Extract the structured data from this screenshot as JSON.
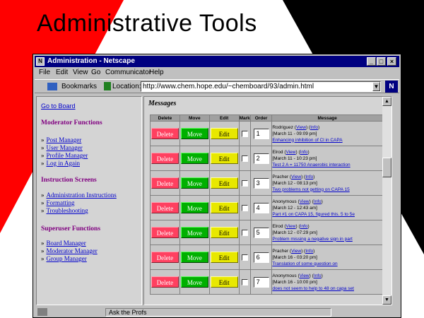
{
  "slide": {
    "title": "Administrative Tools"
  },
  "window": {
    "title": "Administration - Netscape",
    "controls": {
      "minimize": "_",
      "maximize": "□",
      "close": "×"
    }
  },
  "menubar": [
    "File",
    "Edit",
    "View",
    "Go",
    "Communicator",
    "Help"
  ],
  "toolbar": {
    "bookmarks_label": "Bookmarks",
    "location_label": "Location:",
    "url": "http://www.chem.hope.edu/~chemboard/93/admin.html",
    "logo": "N"
  },
  "sidebar": {
    "go_to_board": "Go to Board",
    "moderator_head": "Moderator Functions",
    "moderator_items": [
      "Post Manager",
      "User Manager",
      "Profile Manager",
      "Log in Again"
    ],
    "instruction_head": "Instruction Screens",
    "instruction_items": [
      "Administration Instructions",
      "Formatting",
      "Troubleshooting"
    ],
    "superuser_head": "Superuser Functions",
    "superuser_items": [
      "Board Manager",
      "Moderator Manager",
      "Group Manager"
    ],
    "bullet": "»"
  },
  "main": {
    "title": "Messages",
    "columns": [
      "Delete",
      "Move",
      "Edit",
      "Mark",
      "Order",
      "Message"
    ],
    "buttons": {
      "delete": "Delete",
      "move": "Move",
      "edit": "Edit"
    },
    "view_label": "View",
    "info_label": "Info",
    "rows": [
      {
        "order": "1",
        "author": "Rodriguez",
        "date": "[March 11 - 09:09 pm]",
        "subject": "Enhancing inhibition of Cl in CAPA"
      },
      {
        "order": "2",
        "author": "Elrod",
        "date": "[March 11 - 10:23 pm]",
        "subject": "Test 2 A = 11750 Anaerobic interaction"
      },
      {
        "order": "3",
        "author": "Pracher",
        "date": "[March 12 - 08:13 pm]",
        "subject": "Two problems not getting on CAPA 15"
      },
      {
        "order": "4",
        "author": "Anonymous",
        "date": "[March 12 - 12:43 am]",
        "subject": "Part #1 on CAPA 15, figured this. 5 to 5e"
      },
      {
        "order": "5",
        "author": "Elrod",
        "date": "[March 12 - 07:29 pm]",
        "subject": "Problem missing a negative sign in part"
      },
      {
        "order": "6",
        "author": "Pracher",
        "date": "[March 16 - 03:20 pm]",
        "subject": "Translation of some question on"
      },
      {
        "order": "7",
        "author": "Anonymous",
        "date": "[March 16 - 10:00 pm]",
        "subject": "does not seem to help to 48 on capa set"
      }
    ]
  },
  "status": {
    "text": "Ask the Profs"
  }
}
